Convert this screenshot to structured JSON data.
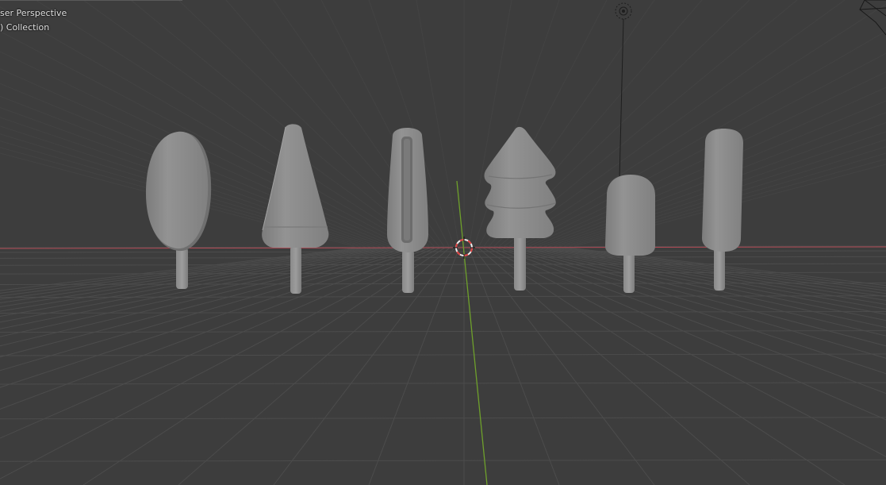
{
  "viewport": {
    "view_label": "ser Perspective",
    "collection_label": ") Collection"
  },
  "colors": {
    "background": "#3d3d3d",
    "grid": "#4c4c4c",
    "x_axis": "#b24a55",
    "y_axis": "#6ea02b",
    "mesh": "#8d8d8d",
    "mesh_shadow": "#6f6f6f",
    "cursor_red": "#e04040",
    "cursor_white": "#f0f0f0"
  },
  "objects": [
    {
      "name": "popsicle-oval",
      "shape": "oval"
    },
    {
      "name": "popsicle-triangle",
      "shape": "triangle"
    },
    {
      "name": "popsicle-slim",
      "shape": "slim"
    },
    {
      "name": "popsicle-tree",
      "shape": "tree"
    },
    {
      "name": "popsicle-short",
      "shape": "short"
    },
    {
      "name": "popsicle-tall",
      "shape": "tall"
    }
  ]
}
